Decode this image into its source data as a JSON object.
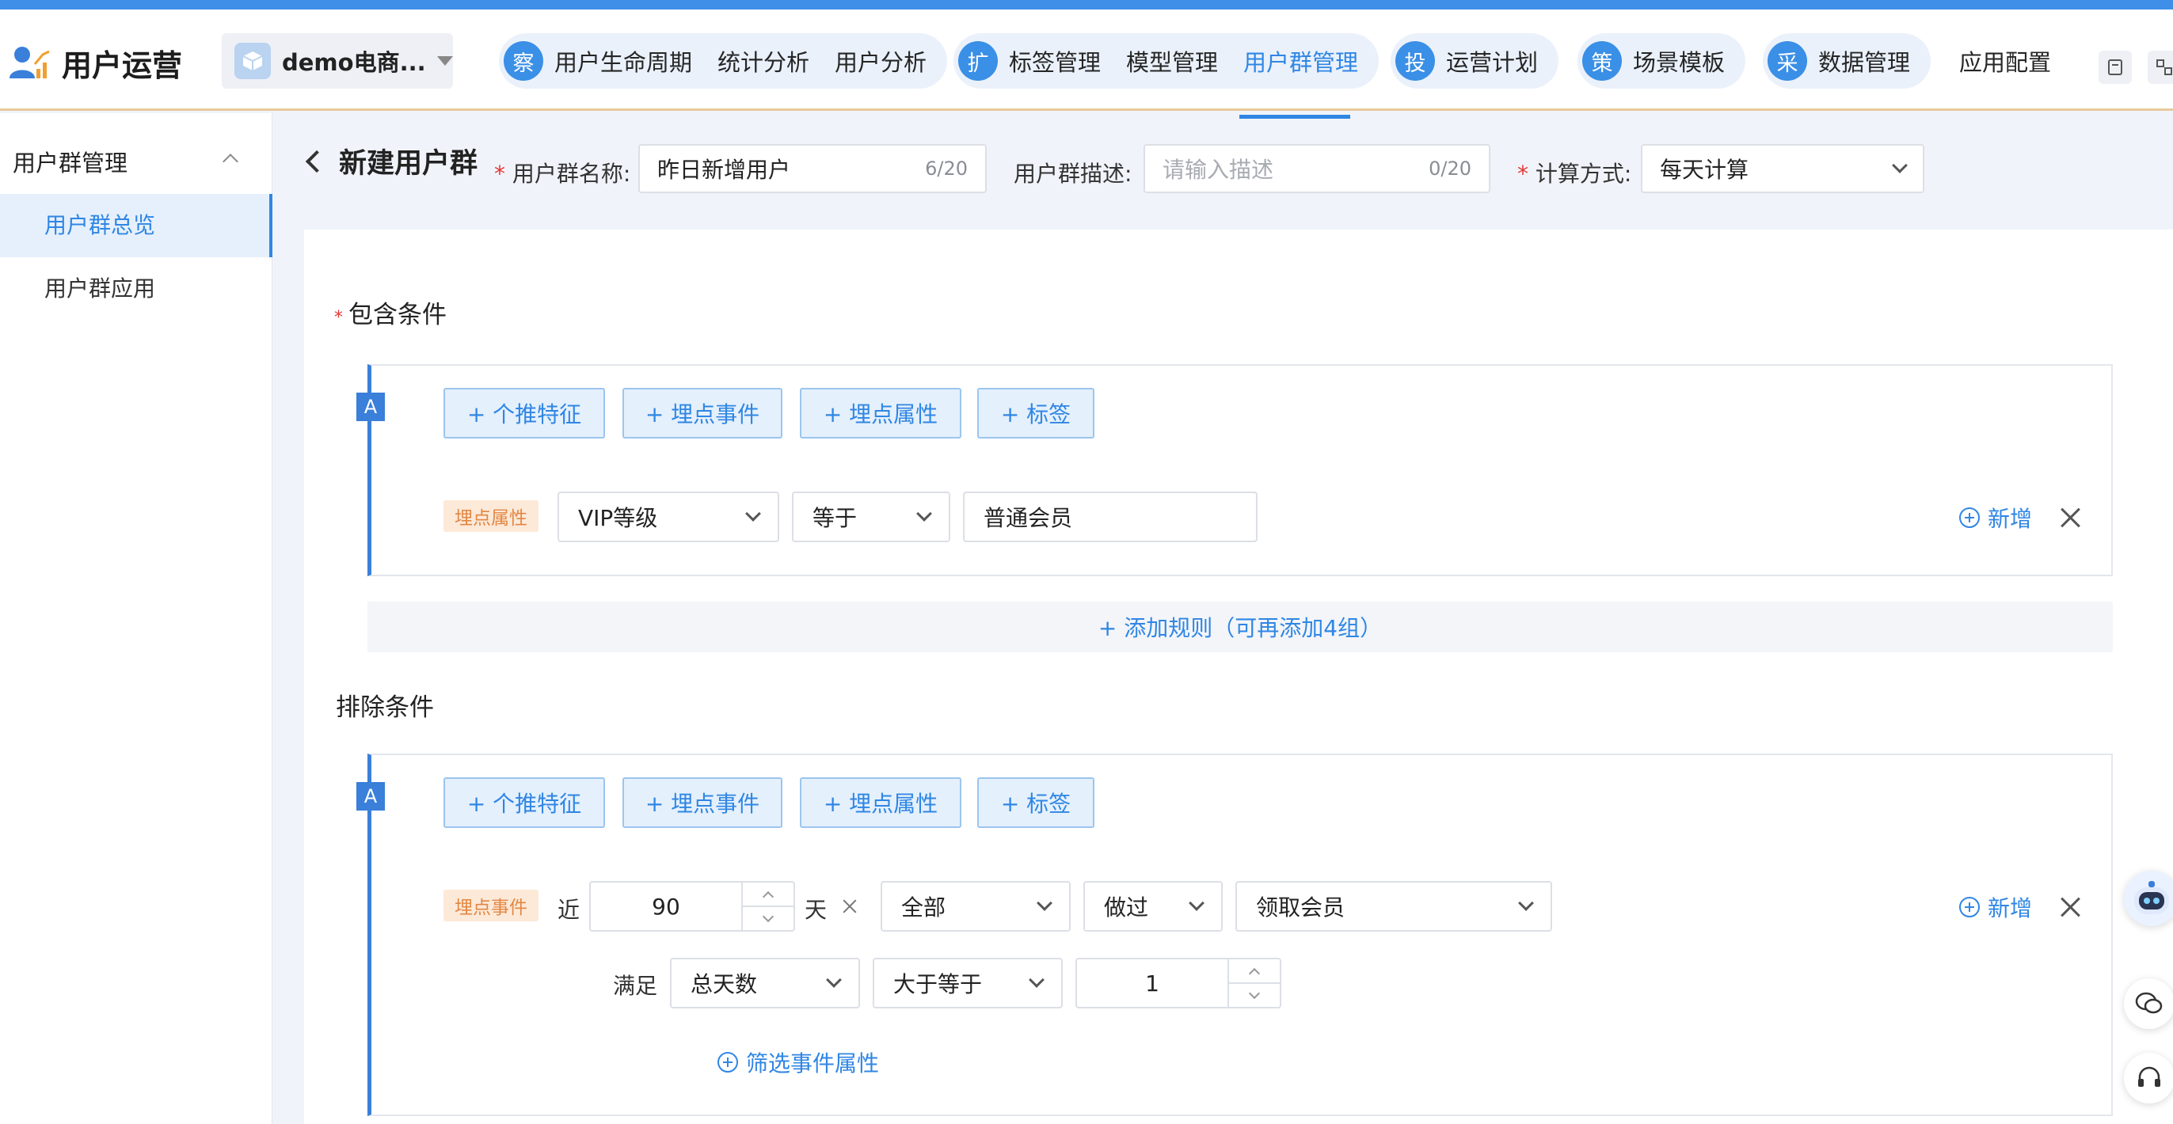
{
  "app": {
    "title": "用户运营",
    "project": "demo电商..."
  },
  "nav": {
    "groups": [
      {
        "badge": "察",
        "items": [
          "用户生命周期",
          "统计分析",
          "用户分析"
        ]
      },
      {
        "badge": "扩",
        "items": [
          "标签管理",
          "模型管理",
          "用户群管理"
        ]
      },
      {
        "badge": "投",
        "items": [
          "运营计划"
        ]
      },
      {
        "badge": "策",
        "items": [
          "场景模板"
        ]
      },
      {
        "badge": "采",
        "items": [
          "数据管理"
        ]
      }
    ],
    "config": "应用配置",
    "active": "用户群管理"
  },
  "sidebar": {
    "header": "用户群管理",
    "items": [
      {
        "label": "用户群总览",
        "active": true
      },
      {
        "label": "用户群应用",
        "active": false
      }
    ]
  },
  "form": {
    "page_title": "新建用户群",
    "name_label": "用户群名称:",
    "name_value": "昨日新增用户",
    "name_count": "6/20",
    "desc_label": "用户群描述:",
    "desc_placeholder": "请输入描述",
    "desc_count": "0/20",
    "calc_label": "计算方式:",
    "calc_value": "每天计算"
  },
  "include": {
    "title": "包含条件",
    "group_tag": "A",
    "buttons": [
      "+ 个推特征",
      "+ 埋点事件",
      "+ 埋点属性",
      "+ 标签"
    ],
    "rule": {
      "type": "埋点属性",
      "field": "VIP等级",
      "op": "等于",
      "value": "普通会员"
    },
    "add_label": "新增",
    "add_rule": "+ 添加规则（可再添加4组）"
  },
  "exclude": {
    "title": "排除条件",
    "group_tag": "A",
    "buttons": [
      "+ 个推特征",
      "+ 埋点事件",
      "+ 埋点属性",
      "+ 标签"
    ],
    "rule": {
      "type": "埋点事件",
      "recent_label": "近",
      "days": "90",
      "days_unit": "天",
      "scope": "全部",
      "action": "做过",
      "event": "领取会员",
      "satisfy_label": "满足",
      "metric": "总天数",
      "compare": "大于等于",
      "threshold": "1",
      "filter_link": "筛选事件属性"
    },
    "add_label": "新增"
  },
  "colors": {
    "accent": "#2f86e4",
    "chip_bg": "#fde9d8",
    "chip_fg": "#e28743",
    "required": "#e53935"
  }
}
